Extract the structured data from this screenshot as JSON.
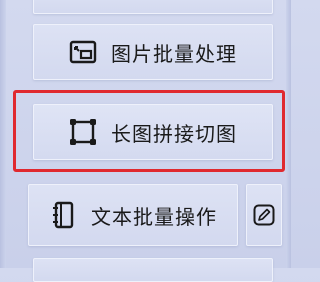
{
  "menu": {
    "batch_image": {
      "label": "图片批量处理",
      "icon": "image-crop-icon"
    },
    "long_image": {
      "label": "长图拼接切图",
      "icon": "selection-square-icon"
    },
    "text_batch": {
      "label": "文本批量操作",
      "icon": "notebook-icon"
    },
    "edit": {
      "icon": "edit-pencil-icon"
    }
  },
  "colors": {
    "highlight_border": "#e0292f",
    "panel_background": "#d3d9ef",
    "text": "#1a1a1a"
  }
}
